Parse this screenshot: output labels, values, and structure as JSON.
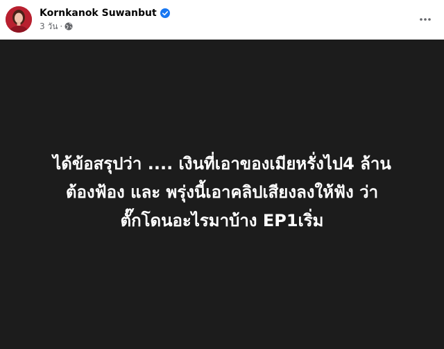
{
  "post": {
    "author": {
      "name": "Kornkanok Suwanbut",
      "verified_icon": "verified-badge-icon",
      "avatar_icon": "profile-avatar"
    },
    "timestamp": "3 วัน",
    "separator": "·",
    "audience_icon": "globe-icon",
    "more_icon": "more-options-icon",
    "colors": {
      "background": "#1c1c1c",
      "text": "#ffffff",
      "verified": "#1877f2",
      "meta": "#65676b"
    },
    "text_lines": [
      "ได้ข้อสรุปว่า .... เงินที่เอาของเมียหรั่งไป4 ล้าน",
      "ต้องฟ้อง และ พรุ่งนี้เอาคลิปเสียงลงให้ฟัง ว่า",
      "ตั๊กโดนอะไรมาบ้าง EP1เริ่ม"
    ]
  }
}
